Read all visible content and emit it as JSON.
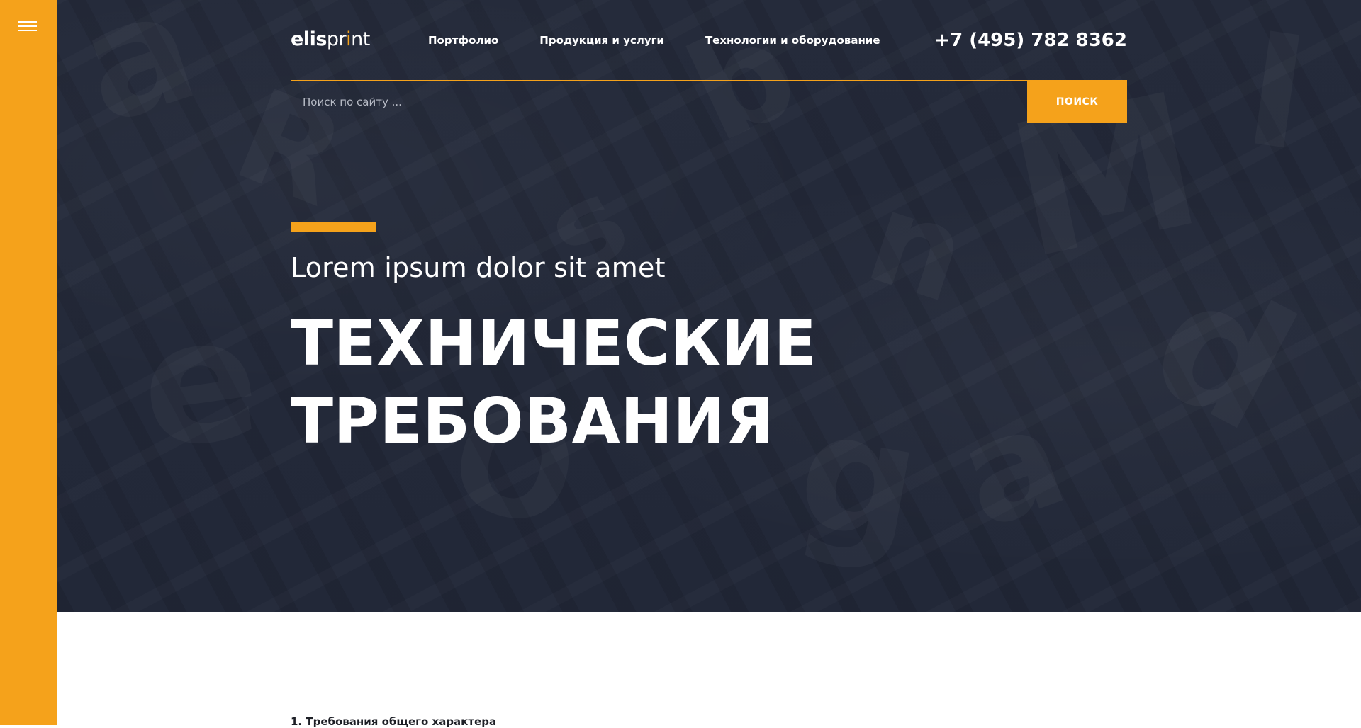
{
  "sidebar": {
    "menu_icon": "hamburger-menu-icon"
  },
  "header": {
    "logo": {
      "part1": "elis",
      "part2": "pr",
      "part3": "i",
      "part4": "nt"
    },
    "nav": [
      {
        "label": "Портфолио"
      },
      {
        "label": "Продукция и услуги"
      },
      {
        "label": "Технологии и оборудование"
      }
    ],
    "phone": "+7 (495) 782 8362"
  },
  "search": {
    "placeholder": "Поиск по сайту ...",
    "value": "",
    "button_label": "ПОИСК"
  },
  "hero": {
    "subtitle": "Lorem ipsum dolor sit amet",
    "title_line1": "ТЕХНИЧЕСКИЕ",
    "title_line2": "ТРЕБОВАНИЯ"
  },
  "content": {
    "section_heading": "1. Требования общего характера"
  },
  "colors": {
    "accent": "#f5a21b",
    "hero_bg": "#242a3a",
    "text_light": "#ffffff",
    "text_dark": "#1d1f26"
  }
}
